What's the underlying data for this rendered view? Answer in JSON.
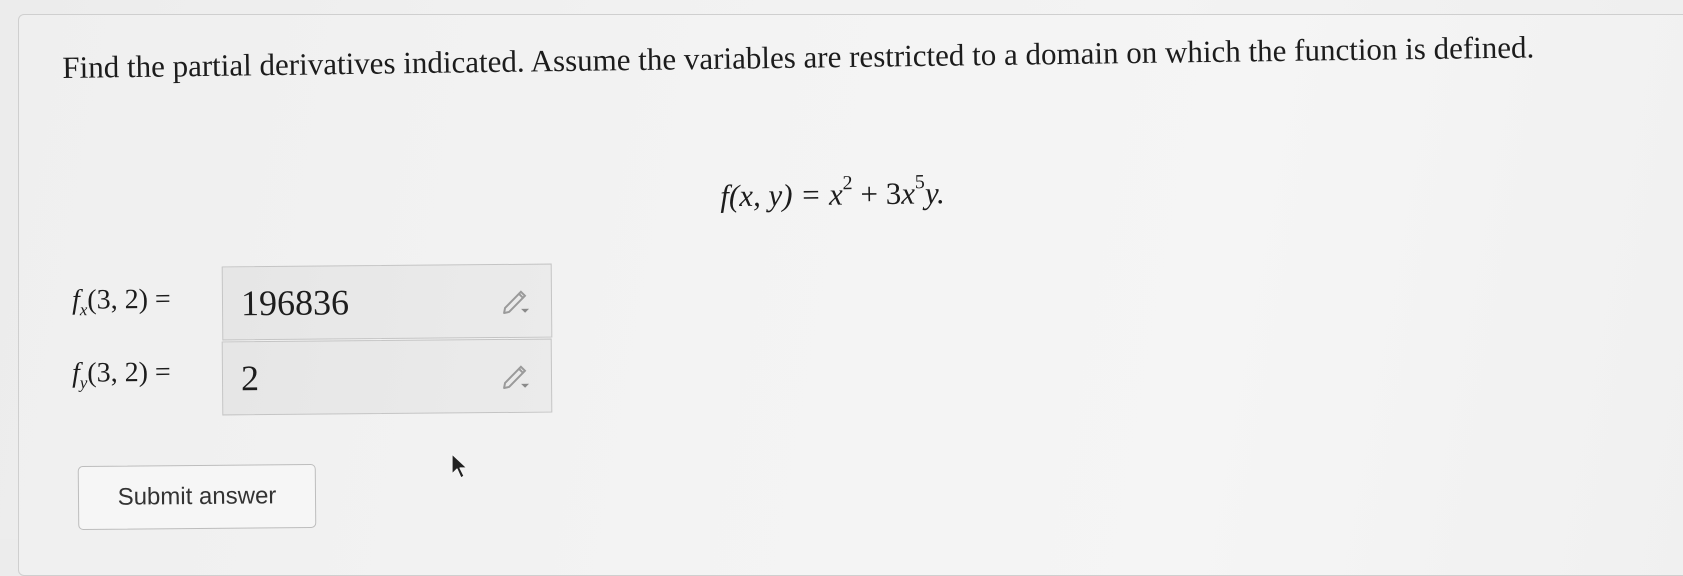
{
  "prompt": {
    "text": "Find the partial derivatives indicated. Assume the variables are restricted to a domain on which the function is defined."
  },
  "equation": {
    "lhs": "f(x, y) = ",
    "term1_base": "x",
    "term1_exp": "2",
    "plus": " + 3",
    "term2_base": "x",
    "term2_exp": "5",
    "tail": "y."
  },
  "answers": [
    {
      "func": "f",
      "sub": "x",
      "args": "(3, 2) =",
      "value": "196836"
    },
    {
      "func": "f",
      "sub": "y",
      "args": "(3, 2) =",
      "value": "2"
    }
  ],
  "submit": {
    "label": "Submit answer"
  },
  "icons": {
    "pencil": "pencil-dropdown-icon",
    "cursor": "mouse-pointer-icon"
  }
}
